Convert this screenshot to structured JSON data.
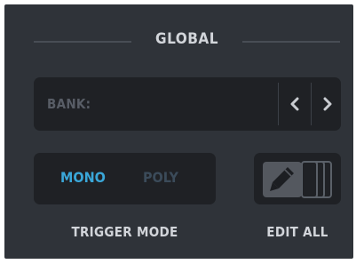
{
  "section": {
    "title": "GLOBAL"
  },
  "bank": {
    "label": "BANK:",
    "prev_icon": "chevron-left-icon",
    "next_icon": "chevron-right-icon"
  },
  "trigger_mode": {
    "options": [
      {
        "label": "MONO",
        "selected": true
      },
      {
        "label": "POLY",
        "selected": false
      }
    ],
    "caption": "TRIGGER MODE"
  },
  "edit_all": {
    "icon": "pencil-icon",
    "caption": "EDIT ALL"
  },
  "colors": {
    "panel": "#2f3339",
    "well": "#1f2125",
    "text": "#d2d5da",
    "accent": "#3aa7d9",
    "inactive": "#3b4b5a"
  }
}
